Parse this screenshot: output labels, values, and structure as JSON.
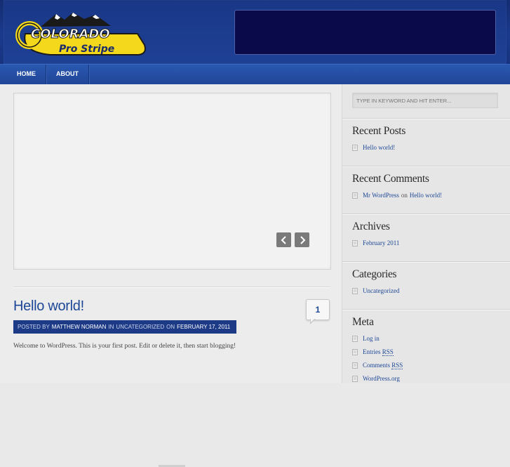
{
  "header": {
    "logo_top": "COLORADO",
    "logo_bottom": "Pro Stripe"
  },
  "nav": {
    "items": [
      {
        "label": "HOME"
      },
      {
        "label": "ABOUT"
      }
    ]
  },
  "post": {
    "title": "Hello world!",
    "comment_count": "1",
    "meta": {
      "posted_by": "POSTED BY",
      "author": "MATTHEW NORMAN",
      "in": "IN",
      "category": "UNCATEGORIZED",
      "on": "ON",
      "date": "FEBRUARY 17, 2011"
    },
    "excerpt": "Welcome to WordPress. This is your first post. Edit or delete it, then start blogging!"
  },
  "sidebar": {
    "search_placeholder": "TYPE IN KEYWORD AND HIT ENTER...",
    "recent_posts": {
      "title": "Recent Posts",
      "items": [
        "Hello world!"
      ]
    },
    "recent_comments": {
      "title": "Recent Comments",
      "author": "Mr WordPress",
      "on": "on",
      "post": "Hello world!"
    },
    "archives": {
      "title": "Archives",
      "items": [
        "February 2011"
      ]
    },
    "categories": {
      "title": "Categories",
      "items": [
        "Uncategorized"
      ]
    },
    "meta": {
      "title": "Meta",
      "login": "Log in",
      "entries": "Entries",
      "comments": "Comments",
      "rss": "RSS",
      "wordpress": "WordPress.org"
    }
  },
  "colors": {
    "header_bg": "#1b3a8c",
    "nav_bg": "#2450a3",
    "link": "#1d4796",
    "logo_yellow": "#f3d81c"
  }
}
